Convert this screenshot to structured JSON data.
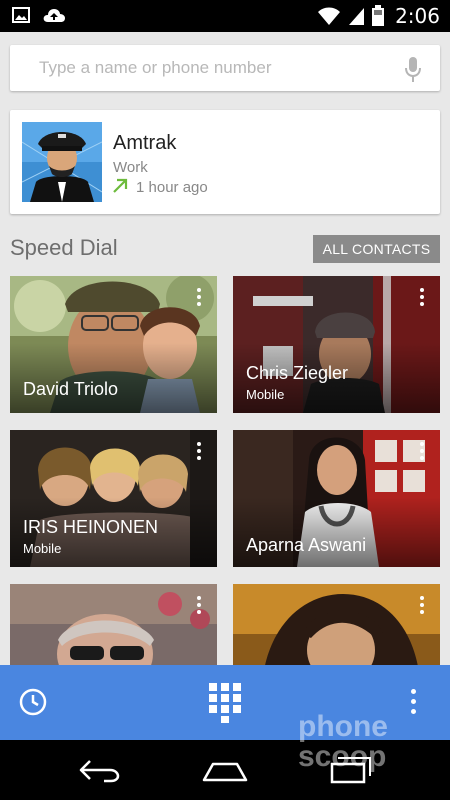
{
  "status_bar": {
    "time": "2:06"
  },
  "search": {
    "placeholder": "Type a name or phone number"
  },
  "recent_call": {
    "name": "Amtrak",
    "phone_type": "Work",
    "time_ago": "1 hour ago"
  },
  "speed_dial": {
    "title": "Speed Dial",
    "all_contacts_label": "ALL CONTACTS",
    "contacts": [
      {
        "name": "David Triolo",
        "sub": ""
      },
      {
        "name": "Chris Ziegler",
        "sub": "Mobile"
      },
      {
        "name": "IRIS HEINONEN",
        "sub": "Mobile"
      },
      {
        "name": "Aparna Aswani",
        "sub": ""
      },
      {
        "name": "",
        "sub": ""
      },
      {
        "name": "",
        "sub": ""
      }
    ]
  },
  "watermark": {
    "line1": "phone",
    "line2": "scoop"
  },
  "colors": {
    "action_bar": "#4a86e0",
    "call_arrow": "#6dbb3c",
    "all_contacts_bg": "#8a8a8a"
  },
  "icons": {
    "status_left": [
      "image-icon",
      "cloud-upload-icon"
    ],
    "status_right": [
      "wifi-icon",
      "signal-icon",
      "battery-icon"
    ],
    "search": "mic-icon",
    "action_bar": [
      "history-icon",
      "dialpad-icon",
      "overflow-menu-icon"
    ],
    "nav": [
      "back-icon",
      "home-icon",
      "recent-apps-icon"
    ]
  }
}
